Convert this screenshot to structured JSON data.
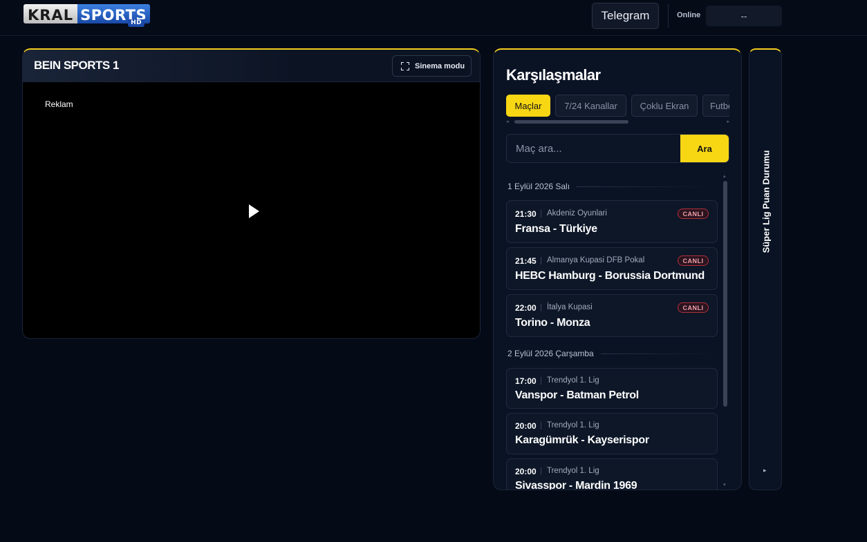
{
  "header": {
    "logo_kral": "KRAL",
    "logo_sports": "SPORTS",
    "logo_hd": "HD",
    "telegram_label": "Telegram",
    "online_label": "Online",
    "online_count": "--"
  },
  "player": {
    "channel_title": "BEIN SPORTS 1",
    "cinema_mode_label": "Sinema modu",
    "ad_label": "Reklam"
  },
  "matches": {
    "title": "Karşılaşmalar",
    "tabs": [
      "Maçlar",
      "7/24 Kanallar",
      "Çoklu Ekran",
      "Futbol"
    ],
    "active_tab": "Maçlar",
    "search_placeholder": "Maç ara...",
    "search_button": "Ara",
    "groups": [
      {
        "date": "1 Eylül 2026 Salı",
        "items": [
          {
            "time": "21:30",
            "league": "Akdeniz Oyunlari",
            "teams": "Fransa - Türkiye",
            "badge": "CANLI"
          },
          {
            "time": "21:45",
            "league": "Almanya Kupasi DFB Pokal",
            "teams": "HEBC Hamburg - Borussia Dortmund",
            "badge": "CANLI"
          },
          {
            "time": "22:00",
            "league": "İtalya Kupasi",
            "teams": "Torino - Monza",
            "badge": "CANLI"
          }
        ]
      },
      {
        "date": "2 Eylül 2026 Çarşamba",
        "items": [
          {
            "time": "17:00",
            "league": "Trendyol 1. Lig",
            "teams": "Vanspor - Batman Petrol"
          },
          {
            "time": "20:00",
            "league": "Trendyol 1. Lig",
            "teams": "Karagümrük - Kayserispor"
          },
          {
            "time": "20:00",
            "league": "Trendyol 1. Lig",
            "teams": "Sivasspor - Mardin 1969"
          }
        ]
      }
    ]
  },
  "standings": {
    "label": "Süper Lig Puan Durumu",
    "arrow": "▸"
  },
  "colors": {
    "accent": "#f7d614",
    "background": "#050a17",
    "panel": "#0a1324",
    "live_badge": "#b3303b"
  },
  "icons": {
    "cinema": "expand-icon",
    "play": "play-icon"
  }
}
